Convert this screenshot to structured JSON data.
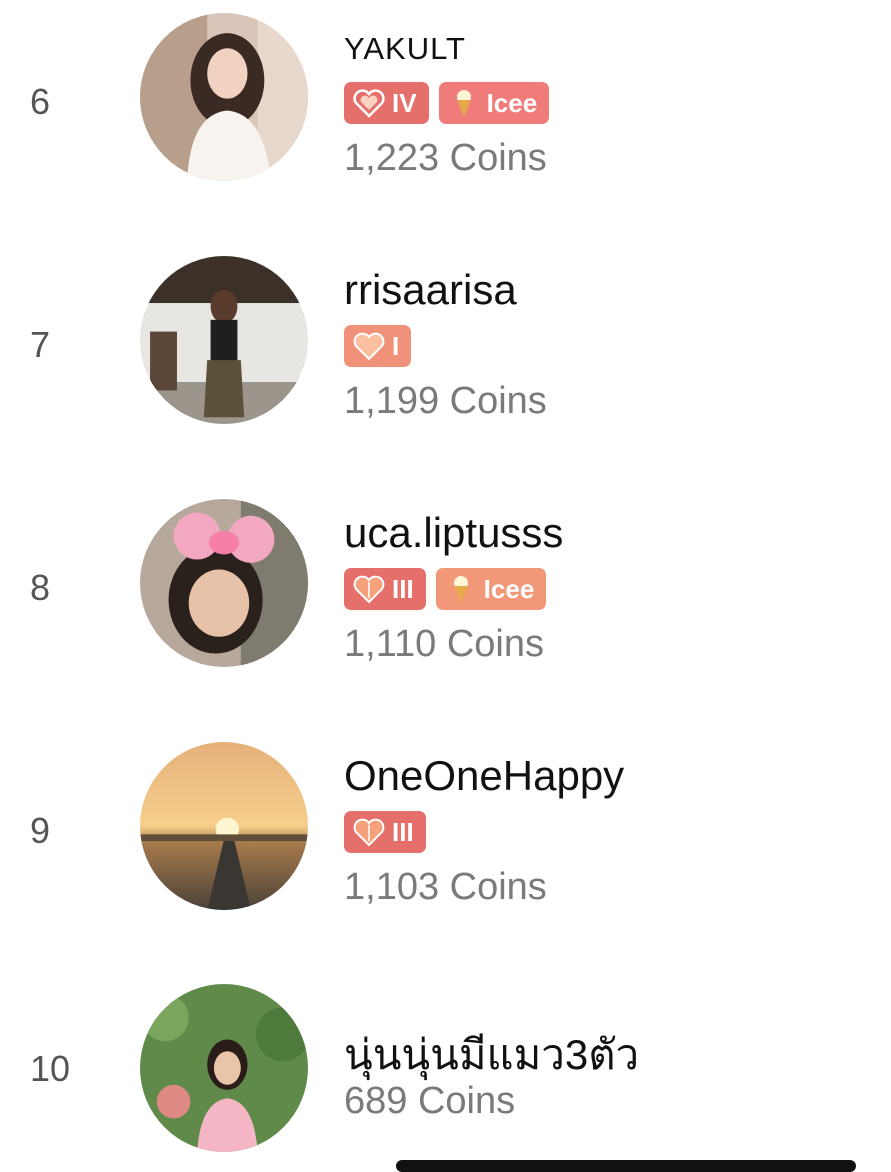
{
  "leaderboard": {
    "entries": [
      {
        "rank": "6",
        "name": "YAKULT",
        "coins": "1,223 Coins",
        "badges": [
          {
            "label": "IV",
            "icon": "heart-level-icon",
            "color": "#e56f6b"
          },
          {
            "label": "Icee",
            "icon": "ice-cream-icon",
            "color": "#ef7c79"
          }
        ]
      },
      {
        "rank": "7",
        "name": "rrisaarisa",
        "coins": "1,199 Coins",
        "badges": [
          {
            "label": "I",
            "icon": "heart-level-icon",
            "color": "#f0927a"
          }
        ]
      },
      {
        "rank": "8",
        "name": "uca.liptusss",
        "coins": "1,110 Coins",
        "badges": [
          {
            "label": "III",
            "icon": "heart-level-icon",
            "color": "#e56f6b"
          },
          {
            "label": "Icee",
            "icon": "ice-cream-icon",
            "color": "#f29879"
          }
        ]
      },
      {
        "rank": "9",
        "name": "OneOneHappy",
        "coins": "1,103 Coins",
        "badges": [
          {
            "label": "III",
            "icon": "heart-level-icon",
            "color": "#e56f6b"
          }
        ]
      },
      {
        "rank": "10",
        "name": "นุ่นนุ่นมีแมว3ตัว",
        "coins": "689 Coins",
        "badges": []
      }
    ]
  }
}
